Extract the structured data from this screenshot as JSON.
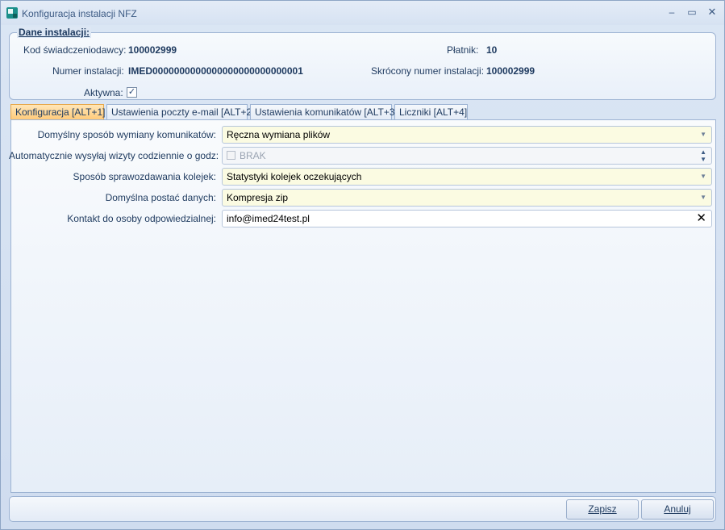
{
  "window": {
    "title": "Konfiguracja instalacji NFZ",
    "min_glyph": "–",
    "max_glyph": "▭",
    "close_glyph": "✕"
  },
  "dane": {
    "legend": "Dane instalacji:",
    "kod_label": "Kod świadczeniodawcy:",
    "kod_value": "100002999",
    "platnik_label": "Płatnik:",
    "platnik_value": "10",
    "numer_label": "Numer instalacji:",
    "numer_value": "IMED0000000000000000000000000001",
    "skrocony_label": "Skrócony numer instalacji:",
    "skrocony_value": "100002999",
    "aktywna_label": "Aktywna:",
    "aktywna_checked": "✓"
  },
  "tabs": [
    {
      "label": "Konfiguracja [ALT+1]"
    },
    {
      "label": "Ustawienia poczty e-mail [ALT+2]"
    },
    {
      "label": "Ustawienia komunikatów [ALT+3]"
    },
    {
      "label": "Liczniki [ALT+4]"
    }
  ],
  "config": {
    "wymiana_label": "Domyślny sposób wymiany komunikatów:",
    "wymiana_value": "Ręczna wymiana plików",
    "auto_label": "Automatycznie wysyłaj wizyty codziennie o godz:",
    "auto_value": "BRAK",
    "sprawozdawanie_label": "Sposób sprawozdawania kolejek:",
    "sprawozdawanie_value": "Statystyki kolejek oczekujących",
    "postac_label": "Domyślna postać danych:",
    "postac_value": "Kompresja zip",
    "kontakt_label": "Kontakt do osoby odpowiedzialnej:",
    "kontakt_value": "info@imed24test.pl"
  },
  "footer": {
    "save_label": "Zapisz",
    "cancel_label": "Anuluj"
  },
  "colors": {
    "active_tab": "#ffc977",
    "field_highlight": "#fbfbe2",
    "label_text": "#1e3a5f"
  }
}
